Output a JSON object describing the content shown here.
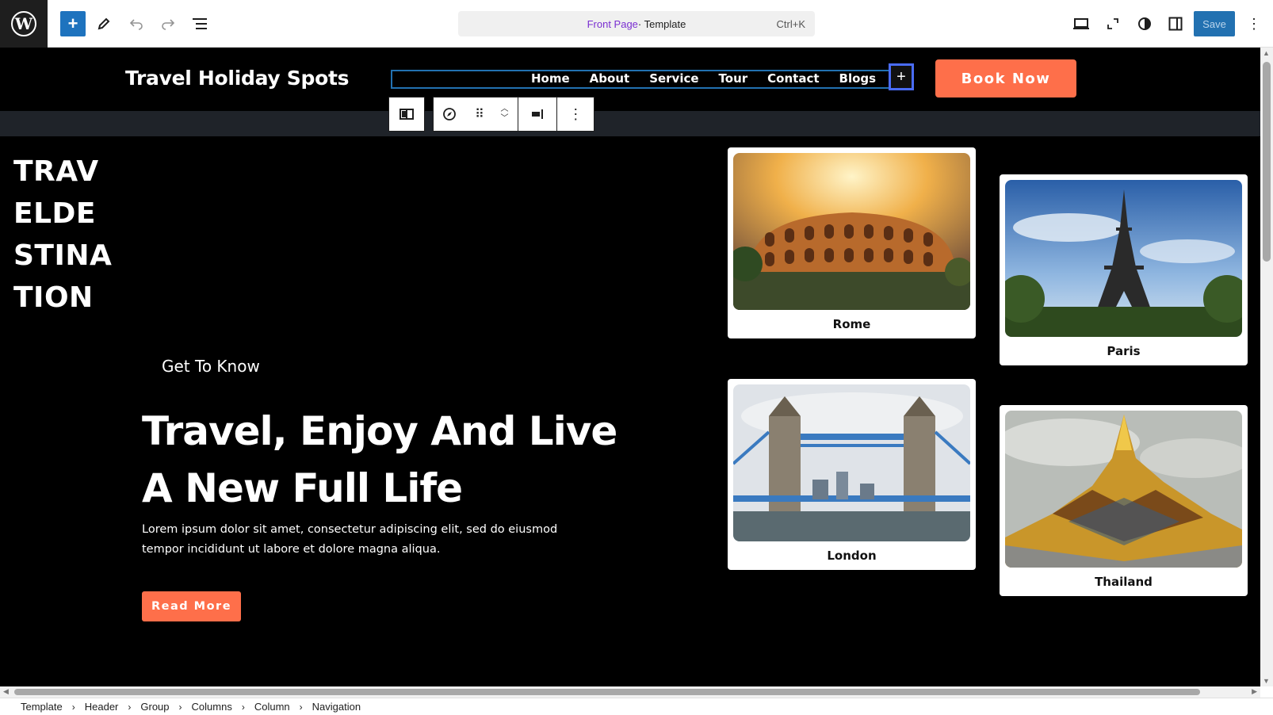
{
  "toolbar": {
    "doc_title_accent": "Front Page",
    "doc_title_rest": " · Template",
    "shortcut": "Ctrl+K",
    "save_label": "Save"
  },
  "header": {
    "site_title": "Travel Holiday Spots",
    "nav": [
      "Home",
      "About",
      "Service",
      "Tour",
      "Contact",
      "Blogs"
    ],
    "book_label": "Book Now"
  },
  "hero": {
    "vertical_title": "TRAVELDESTINATION",
    "subheading": "Get To Know",
    "heading_line1": "Travel, Enjoy And Live",
    "heading_line2": "A New Full Life",
    "description": "Lorem ipsum dolor sit amet, consectetur adipiscing elit, sed do eiusmod tempor incididunt ut labore et dolore magna aliqua.",
    "read_more": "Read More"
  },
  "cards": [
    {
      "label": "Rome"
    },
    {
      "label": "Paris"
    },
    {
      "label": "London"
    },
    {
      "label": "Thailand"
    }
  ],
  "breadcrumb": [
    "Template",
    "Header",
    "Group",
    "Columns",
    "Column",
    "Navigation"
  ],
  "colors": {
    "accent": "#fe6f4a",
    "wp_blue": "#2271b1",
    "selection": "#4a6cf7"
  }
}
